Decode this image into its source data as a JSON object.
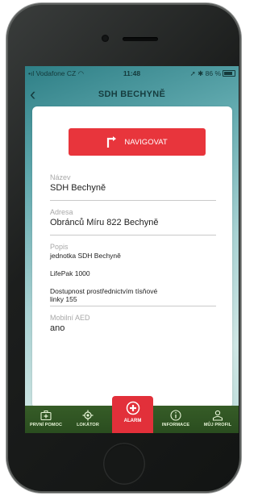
{
  "status": {
    "carrier": "Vodafone CZ",
    "time": "11:48",
    "battery": "86 %"
  },
  "header": {
    "title": "SDH BECHYNĚ"
  },
  "navigate_button": {
    "label": "NAVIGOVAT"
  },
  "fields": {
    "name": {
      "label": "Název",
      "value": "SDH Bechyně"
    },
    "address": {
      "label": "Adresa",
      "value": "Obránců Míru 822 Bechyně"
    },
    "description": {
      "label": "Popis",
      "lines": [
        "jednotka SDH Bechyně",
        "LifePak 1000",
        "Dostupnost prostřednictvím tísňové linky 155"
      ]
    },
    "mobile_aed": {
      "label": "Mobilní AED",
      "value": "ano"
    }
  },
  "tabs": [
    {
      "label": "PRVNÍ POMOC",
      "icon": "first-aid-kit-icon"
    },
    {
      "label": "LOKÁTOR",
      "icon": "locator-icon"
    },
    {
      "label": "ALARM",
      "icon": "alarm-plus-icon"
    },
    {
      "label": "INFORMACE",
      "icon": "info-icon"
    },
    {
      "label": "MŮJ PROFIL",
      "icon": "profile-icon"
    }
  ],
  "colors": {
    "accent_red": "#e8353c",
    "tabbar_green": "#2f5523"
  }
}
